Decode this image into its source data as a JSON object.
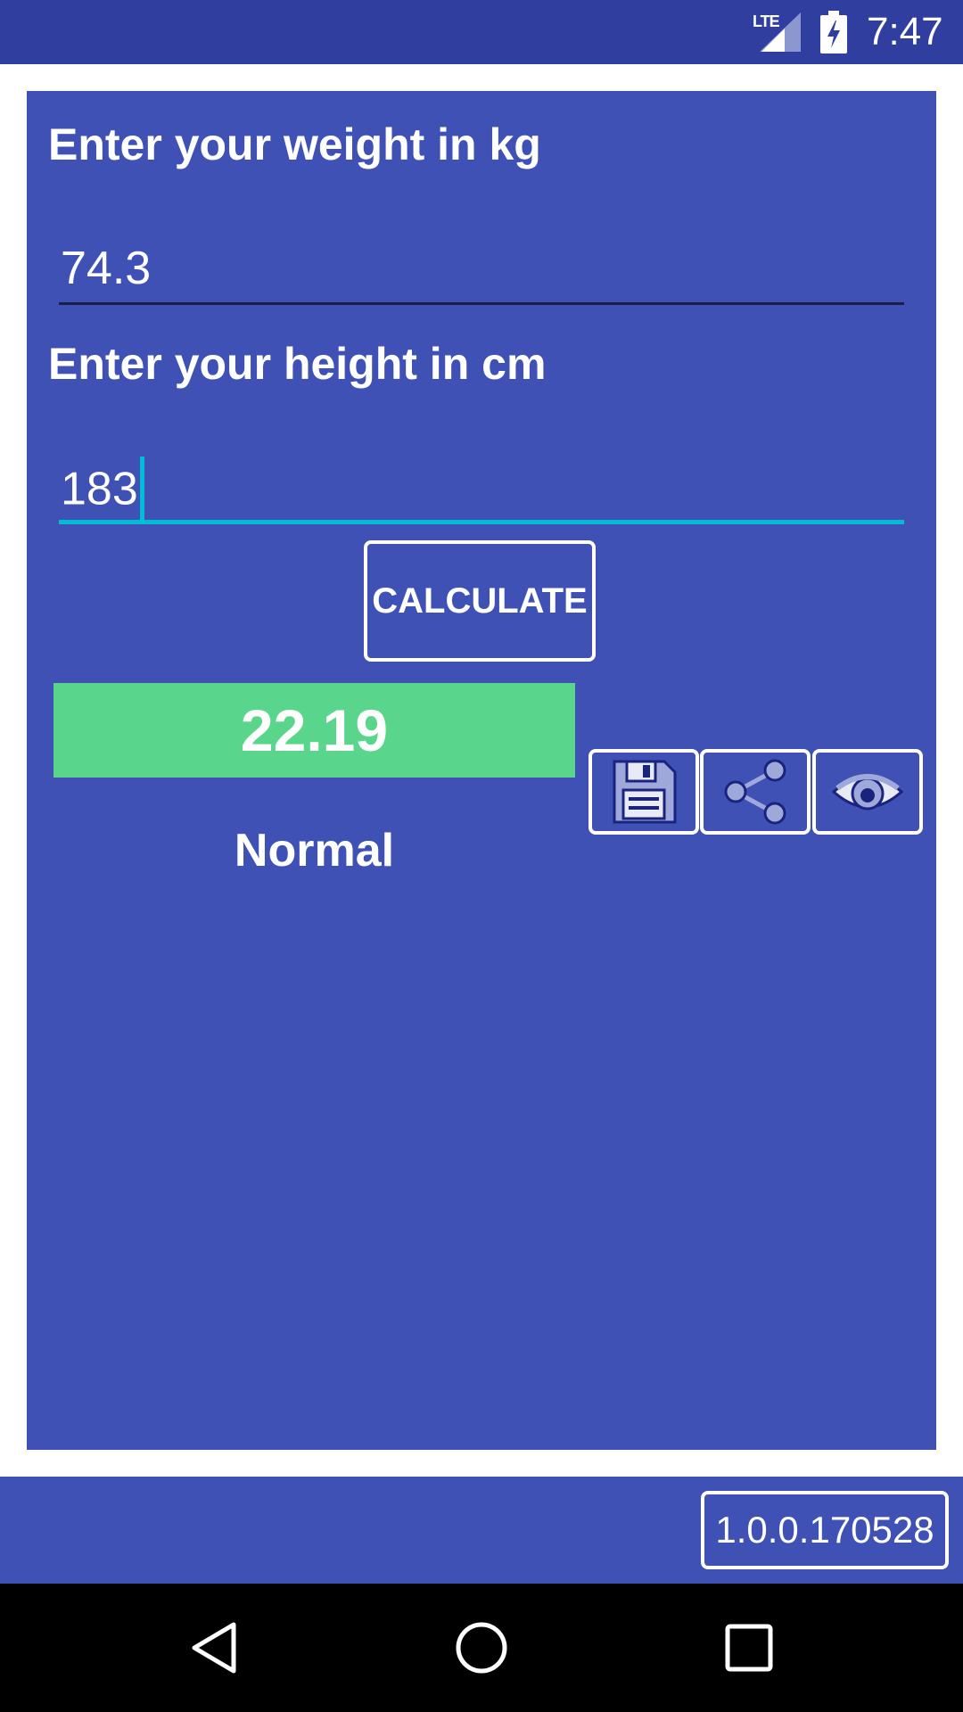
{
  "status_bar": {
    "network": "LTE",
    "time": "7:47"
  },
  "form": {
    "weight_label": "Enter your weight in kg",
    "weight_value": "74.3",
    "height_label": "Enter your height in cm",
    "height_value": "183",
    "calculate_label": "CALCULATE"
  },
  "result": {
    "bmi_value": "22.19",
    "category": "Normal",
    "result_color": "#5ad68c"
  },
  "actions": [
    "save-icon",
    "share-icon",
    "eye-icon"
  ],
  "footer": {
    "version": "1.0.0.170528"
  },
  "colors": {
    "primary": "#3f51b5",
    "primary_dark": "#303f9f",
    "accent": "#00bcd4"
  }
}
